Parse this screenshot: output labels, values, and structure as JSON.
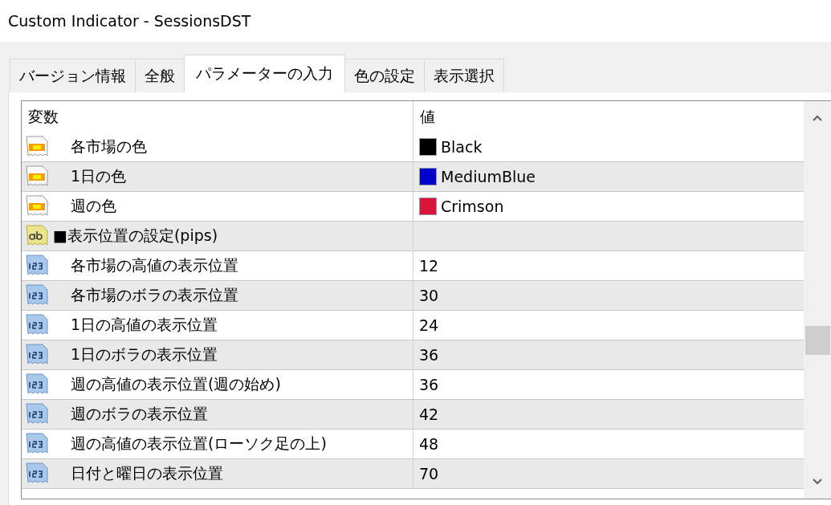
{
  "window": {
    "title": "Custom Indicator - SessionsDST"
  },
  "tabs": [
    {
      "label": "バージョン情報",
      "selected": false
    },
    {
      "label": "全般",
      "selected": false
    },
    {
      "label": "パラメーターの入力",
      "selected": true
    },
    {
      "label": "色の設定",
      "selected": false
    },
    {
      "label": "表示選択",
      "selected": false
    }
  ],
  "table": {
    "columns": [
      "変数",
      "値"
    ],
    "rows": [
      {
        "kind": "color",
        "name": "各市場の色",
        "value": "Black",
        "color": "#000000"
      },
      {
        "kind": "color",
        "name": "1日の色",
        "value": "MediumBlue",
        "color": "#0000cd"
      },
      {
        "kind": "color",
        "name": "週の色",
        "value": "Crimson",
        "color": "#dc143c"
      },
      {
        "kind": "string",
        "name": "■表示位置の設定(pips)"
      },
      {
        "kind": "int",
        "name": "各市場の高値の表示位置",
        "value": "12"
      },
      {
        "kind": "int",
        "name": "各市場のボラの表示位置",
        "value": "30"
      },
      {
        "kind": "int",
        "name": "1日の高値の表示位置",
        "value": "24"
      },
      {
        "kind": "int",
        "name": "1日のボラの表示位置",
        "value": "36"
      },
      {
        "kind": "int",
        "name": "週の高値の表示位置(週の始め)",
        "value": "36"
      },
      {
        "kind": "int",
        "name": "週のボラの表示位置",
        "value": "42"
      },
      {
        "kind": "int",
        "name": "週の高値の表示位置(ローソク足の上)",
        "value": "48"
      },
      {
        "kind": "int",
        "name": "日付と曜日の表示位置",
        "value": "70"
      }
    ]
  }
}
